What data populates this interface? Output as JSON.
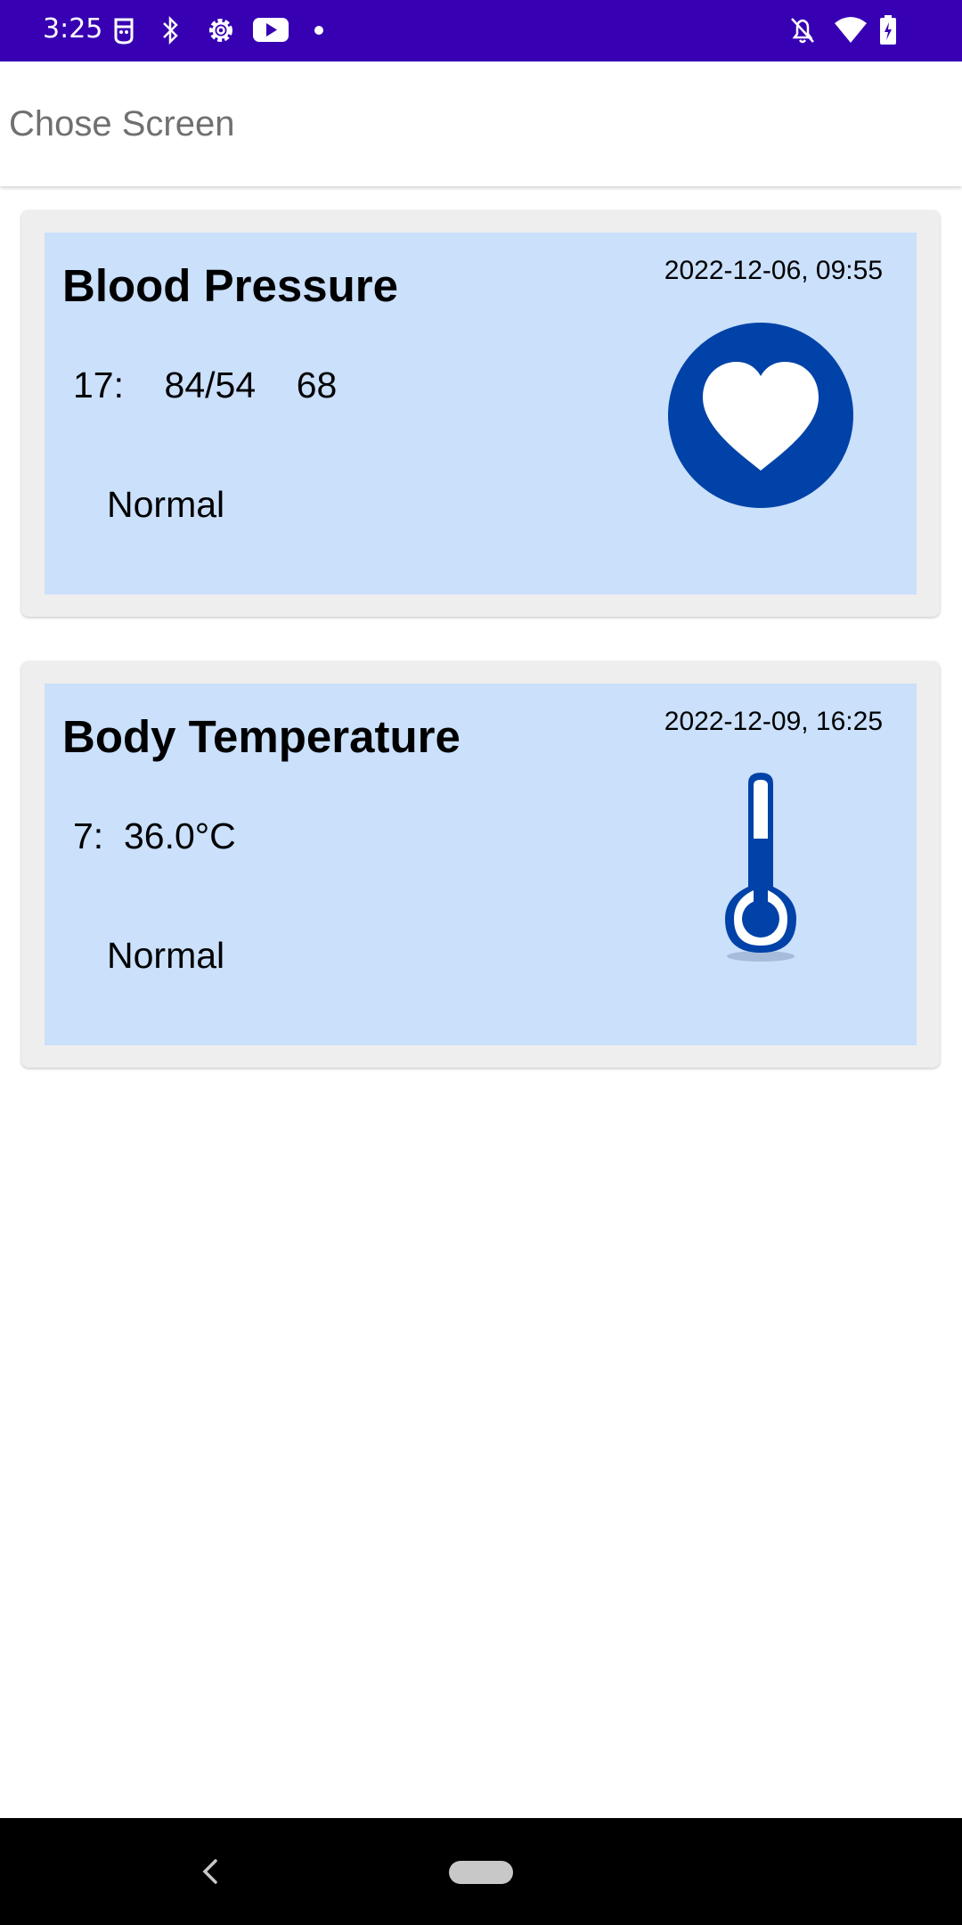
{
  "status_bar": {
    "time": "3:25",
    "icons": [
      "face-icon",
      "bluetooth-icon",
      "settings-icon",
      "youtube-icon",
      "dot-icon",
      "bell-off-icon",
      "wifi-icon",
      "battery-charging-icon"
    ]
  },
  "app_bar": {
    "title": "Chose Screen"
  },
  "cards": [
    {
      "title": "Blood Pressure",
      "date": "2022-12-06, 09:55",
      "reading": "17:    84/54    68",
      "status": "Normal",
      "icon": "heart-icon"
    },
    {
      "title": "Body Temperature",
      "date": "2022-12-09, 16:25",
      "reading": "7:  36.0°C",
      "status": "Normal",
      "icon": "thermometer-icon"
    }
  ],
  "colors": {
    "status_bar": "#3700b3",
    "card_background": "#cae0fb",
    "icon_blue": "#0042a8"
  },
  "nav_bar": {
    "icons": [
      "back-icon",
      "home-pill-icon"
    ]
  }
}
